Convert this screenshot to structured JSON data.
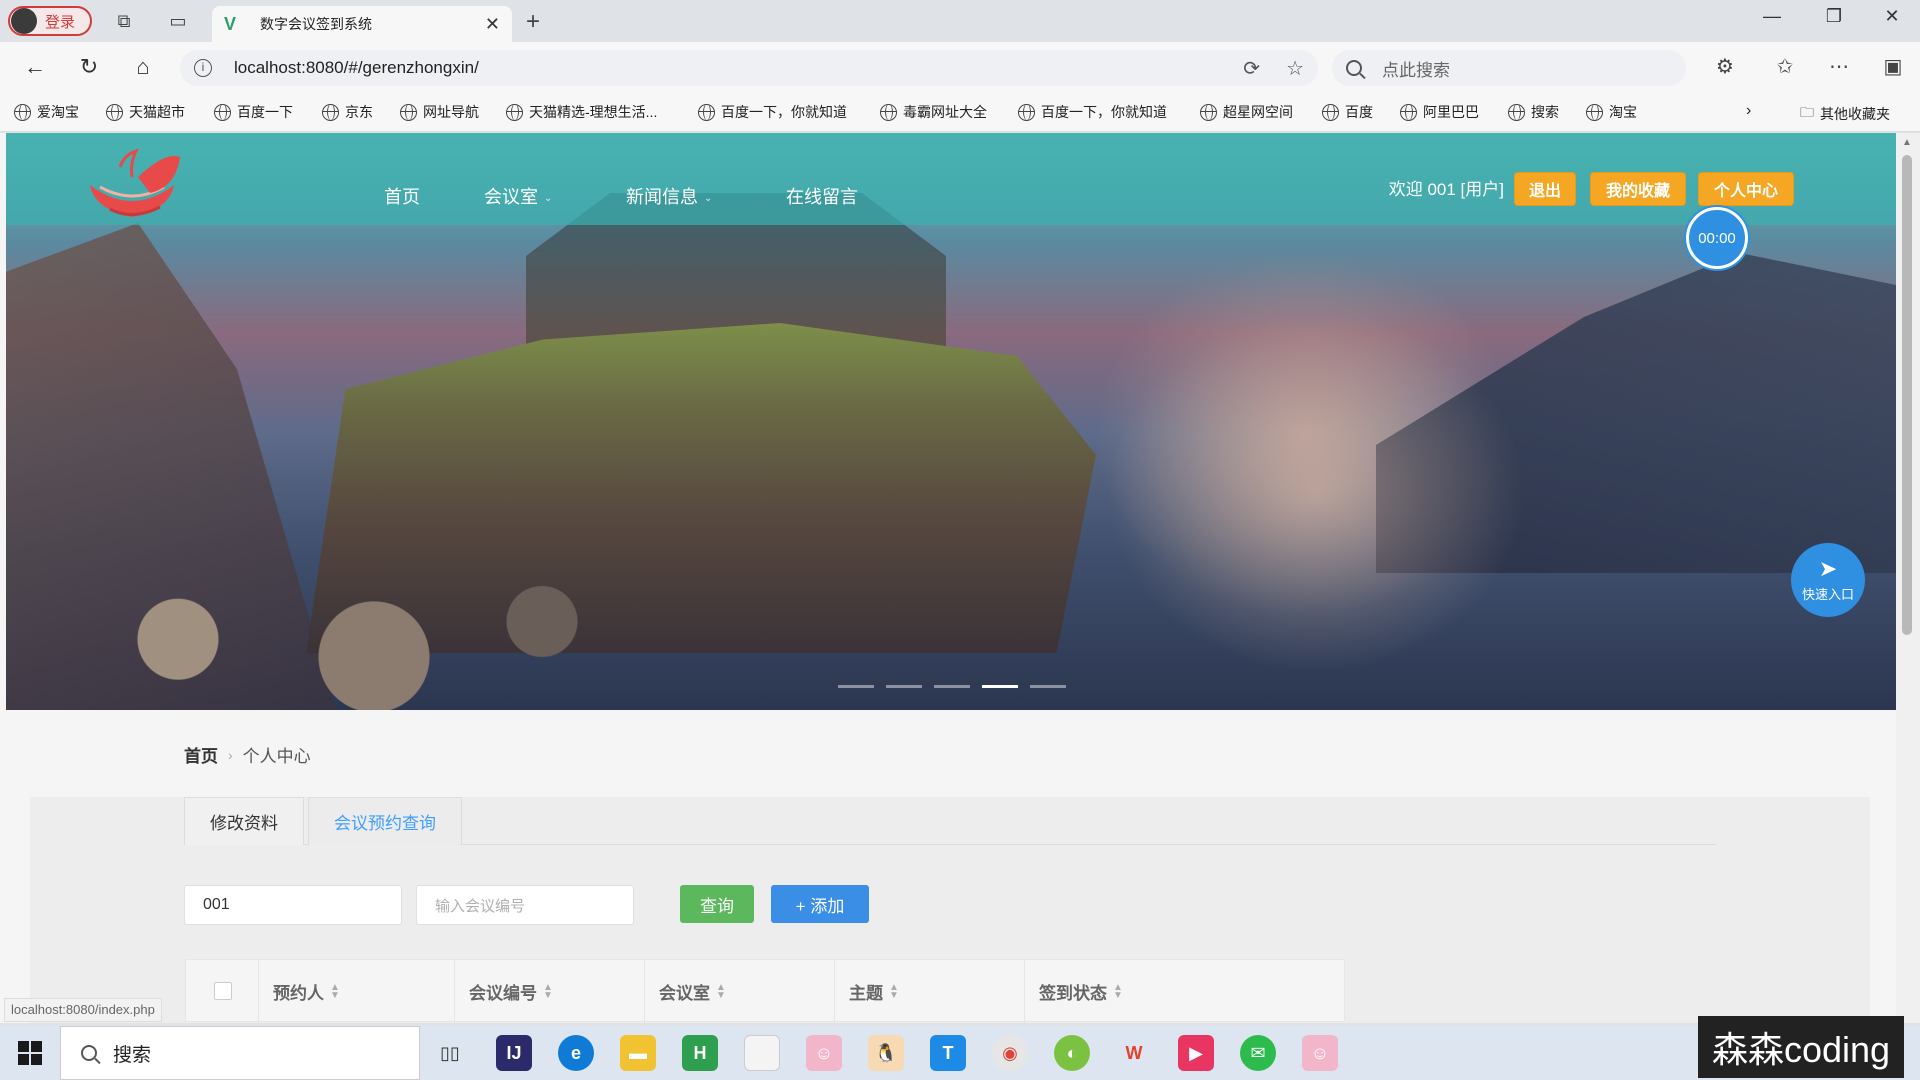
{
  "browser": {
    "profile_label": "登录",
    "tab_title": "数字会议签到系统",
    "url": "localhost:8080/#/gerenzhongxin/",
    "search_placeholder": "点此搜索",
    "bookmarks": [
      "爱淘宝",
      "天猫超市",
      "百度一下",
      "京东",
      "网址导航",
      "天猫精选-理想生活...",
      "百度一下，你就知道",
      "毒霸网址大全",
      "百度一下，你就知道",
      "超星网空间",
      "百度",
      "阿里巴巴",
      "搜索",
      "淘宝"
    ],
    "other_bookmarks": "其他收藏夹",
    "status_url": "localhost:8080/index.php"
  },
  "site": {
    "nav": [
      "首页",
      "会议室",
      "新闻信息",
      "在线留言"
    ],
    "welcome": "欢迎 001 [用户]",
    "buttons": {
      "logout": "退出",
      "favorites": "我的收藏",
      "personal_center": "个人中心"
    },
    "timer": "00:00",
    "quick_entry": "快速入口",
    "carousel": {
      "slide_count": 5,
      "active_index": 3
    }
  },
  "breadcrumb": {
    "home": "首页",
    "current": "个人中心"
  },
  "panel": {
    "tabs": [
      "修改资料",
      "会议预约查询"
    ],
    "active_tab": 1,
    "search_value": "001",
    "meeting_no_placeholder": "输入会议编号",
    "query_button": "查询",
    "add_button": "+ 添加"
  },
  "table": {
    "headers": [
      "预约人",
      "会议编号",
      "会议室",
      "主题",
      "签到状态"
    ]
  },
  "taskbar": {
    "search_label": "搜索",
    "watermark": "森森coding"
  },
  "colors": {
    "header_teal": "#3ab0b0",
    "accent_orange": "#f5a623",
    "primary_blue": "#409eff",
    "query_green": "#5cb85c"
  }
}
